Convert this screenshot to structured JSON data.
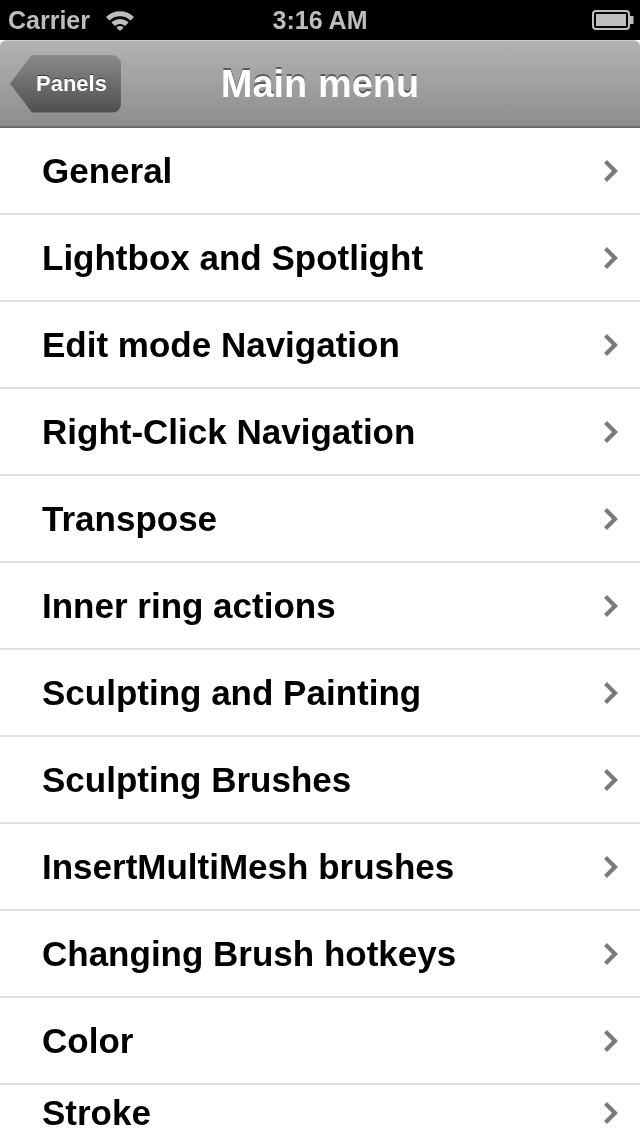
{
  "status_bar": {
    "carrier": "Carrier",
    "time": "3:16 AM"
  },
  "nav_bar": {
    "back_button": "Panels",
    "title": "Main menu"
  },
  "menu_items": [
    {
      "label": "General"
    },
    {
      "label": "Lightbox and Spotlight"
    },
    {
      "label": "Edit mode Navigation"
    },
    {
      "label": "Right-Click Navigation"
    },
    {
      "label": "Transpose"
    },
    {
      "label": "Inner ring actions"
    },
    {
      "label": "Sculpting and Painting"
    },
    {
      "label": "Sculpting Brushes"
    },
    {
      "label": "InsertMultiMesh brushes"
    },
    {
      "label": "Changing Brush hotkeys"
    },
    {
      "label": "Color"
    },
    {
      "label": "Stroke"
    }
  ]
}
